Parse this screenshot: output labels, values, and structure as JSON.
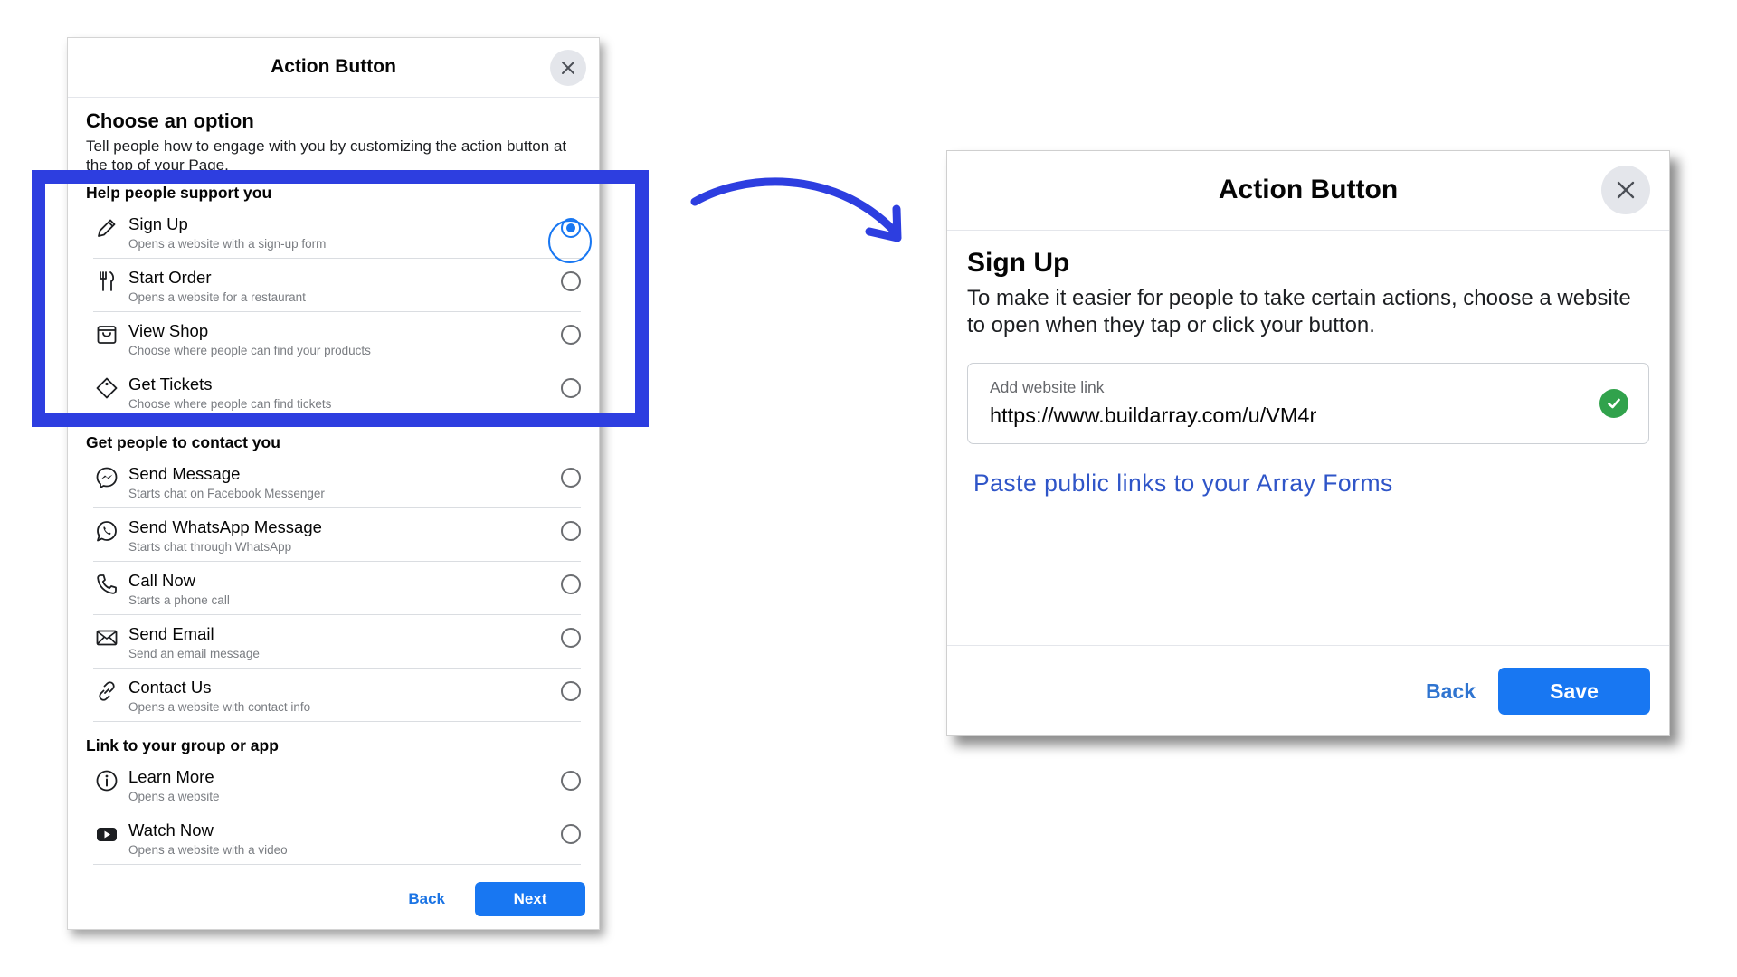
{
  "left_dialog": {
    "title": "Action Button",
    "intro_title": "Choose an option",
    "intro_desc": "Tell people how to engage with you by customizing the action button at the top of your Page.",
    "sections": [
      {
        "title": "Help people support you",
        "options": [
          {
            "label": "Sign Up",
            "sub": "Opens a website with a sign-up form",
            "icon": "pencil-icon",
            "selected": true
          },
          {
            "label": "Start Order",
            "sub": "Opens a website for a restaurant",
            "icon": "utensils-icon",
            "selected": false
          },
          {
            "label": "View Shop",
            "sub": "Choose where people can find your products",
            "icon": "shop-icon",
            "selected": false
          },
          {
            "label": "Get Tickets",
            "sub": "Choose where people can find tickets",
            "icon": "ticket-icon",
            "selected": false
          }
        ]
      },
      {
        "title": "Get people to contact you",
        "options": [
          {
            "label": "Send Message",
            "sub": "Starts chat on Facebook Messenger",
            "icon": "messenger-icon",
            "selected": false
          },
          {
            "label": "Send WhatsApp Message",
            "sub": "Starts chat through WhatsApp",
            "icon": "whatsapp-icon",
            "selected": false
          },
          {
            "label": "Call Now",
            "sub": "Starts a phone call",
            "icon": "phone-icon",
            "selected": false
          },
          {
            "label": "Send Email",
            "sub": "Send an email message",
            "icon": "envelope-icon",
            "selected": false
          },
          {
            "label": "Contact Us",
            "sub": "Opens a website with contact info",
            "icon": "link-icon",
            "selected": false
          }
        ]
      },
      {
        "title": "Link to your group or app",
        "options": [
          {
            "label": "Learn More",
            "sub": "Opens a website",
            "icon": "info-icon",
            "selected": false
          },
          {
            "label": "Watch Now",
            "sub": "Opens a website with a video",
            "icon": "video-play-icon",
            "selected": false
          }
        ]
      }
    ],
    "back_label": "Back",
    "next_label": "Next"
  },
  "right_dialog": {
    "title": "Action Button",
    "heading": "Sign Up",
    "description": "To make it easier for people to take certain actions, choose a website to open when they tap or click your button.",
    "field_label": "Add website link",
    "field_value": "https://www.buildarray.com/u/VM4r",
    "paste_link": "Paste public links to your Array Forms",
    "back_label": "Back",
    "save_label": "Save"
  },
  "colors": {
    "highlight": "#2d3ee0",
    "primary_button": "#1877f2",
    "link": "#2f55c8",
    "success": "#31a24c"
  }
}
